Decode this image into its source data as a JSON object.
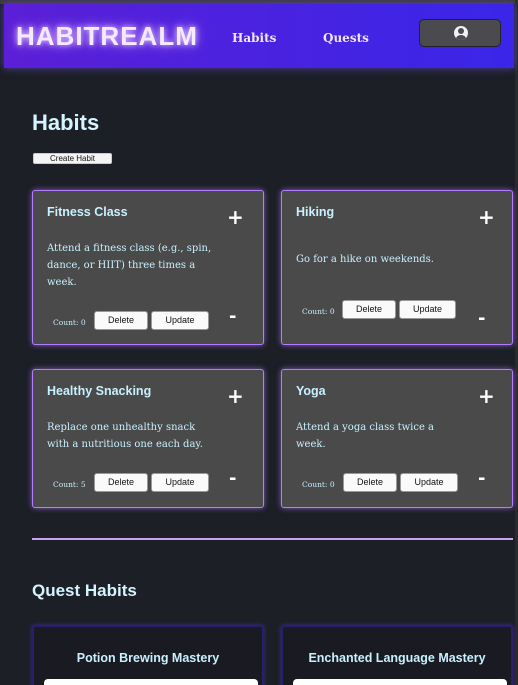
{
  "header": {
    "logo": "HABITREALM",
    "nav": {
      "habits": "Habits",
      "quests": "Quests"
    },
    "profile_icon": "user-circle-icon"
  },
  "habits_section": {
    "title": "Habits",
    "create_label": "Create Habit",
    "cards": [
      {
        "name": "Fitness Class",
        "desc": "Attend a fitness class (e.g., spin, dance, or HIIT) three times a week.",
        "count": "Count: 0",
        "delete": "Delete",
        "update": "Update",
        "plus": "+",
        "minus": "-"
      },
      {
        "name": "Hiking",
        "desc": "Go for a hike on weekends.",
        "count": "Count: 0",
        "delete": "Delete",
        "update": "Update",
        "plus": "+",
        "minus": "-"
      },
      {
        "name": "Healthy Snacking",
        "desc": "Replace one unhealthy snack with a nutritious one each day.",
        "count": "Count: 5",
        "delete": "Delete",
        "update": "Update",
        "plus": "+",
        "minus": "-"
      },
      {
        "name": "Yoga",
        "desc": "Attend a yoga class twice a week.",
        "count": "Count: 0",
        "delete": "Delete",
        "update": "Update",
        "plus": "+",
        "minus": "-"
      }
    ]
  },
  "quest_section": {
    "title": "Quest Habits",
    "quests": [
      {
        "name": "Potion Brewing Mastery"
      },
      {
        "name": "Enchanted Language Mastery"
      }
    ]
  },
  "colors": {
    "accent": "#b47dff",
    "header_start": "#5b1fd6",
    "header_end": "#3a26e8",
    "text_cyan": "#c8f0ff"
  }
}
